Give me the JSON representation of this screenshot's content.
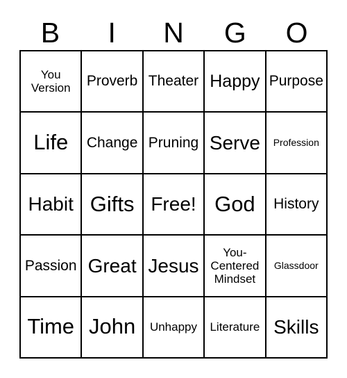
{
  "card": {
    "title": "BINGO",
    "header_letters": [
      "B",
      "I",
      "N",
      "G",
      "O"
    ],
    "colors": {
      "background": "#ffffff",
      "border": "#000000",
      "text": "#000000"
    },
    "rows": [
      [
        {
          "text": "You Version",
          "size": "sm"
        },
        {
          "text": "Proverb",
          "size": "md"
        },
        {
          "text": "Theater",
          "size": "md"
        },
        {
          "text": "Happy",
          "size": "lg"
        },
        {
          "text": "Purpose",
          "size": "md"
        }
      ],
      [
        {
          "text": "Life",
          "size": "xxl"
        },
        {
          "text": "Change",
          "size": "md"
        },
        {
          "text": "Pruning",
          "size": "md"
        },
        {
          "text": "Serve",
          "size": "xl"
        },
        {
          "text": "Profession",
          "size": "xs"
        }
      ],
      [
        {
          "text": "Habit",
          "size": "xl"
        },
        {
          "text": "Gifts",
          "size": "xxl"
        },
        {
          "text": "Free!",
          "size": "xl"
        },
        {
          "text": "God",
          "size": "xxl"
        },
        {
          "text": "History",
          "size": "md"
        }
      ],
      [
        {
          "text": "Passion",
          "size": "md"
        },
        {
          "text": "Great",
          "size": "xl"
        },
        {
          "text": "Jesus",
          "size": "xl"
        },
        {
          "text": "You-Centered Mindset",
          "size": "sm"
        },
        {
          "text": "Glassdoor",
          "size": "xs"
        }
      ],
      [
        {
          "text": "Time",
          "size": "xxl"
        },
        {
          "text": "John",
          "size": "xxl"
        },
        {
          "text": "Unhappy",
          "size": "sm"
        },
        {
          "text": "Literature",
          "size": "sm"
        },
        {
          "text": "Skills",
          "size": "xl"
        }
      ]
    ]
  }
}
